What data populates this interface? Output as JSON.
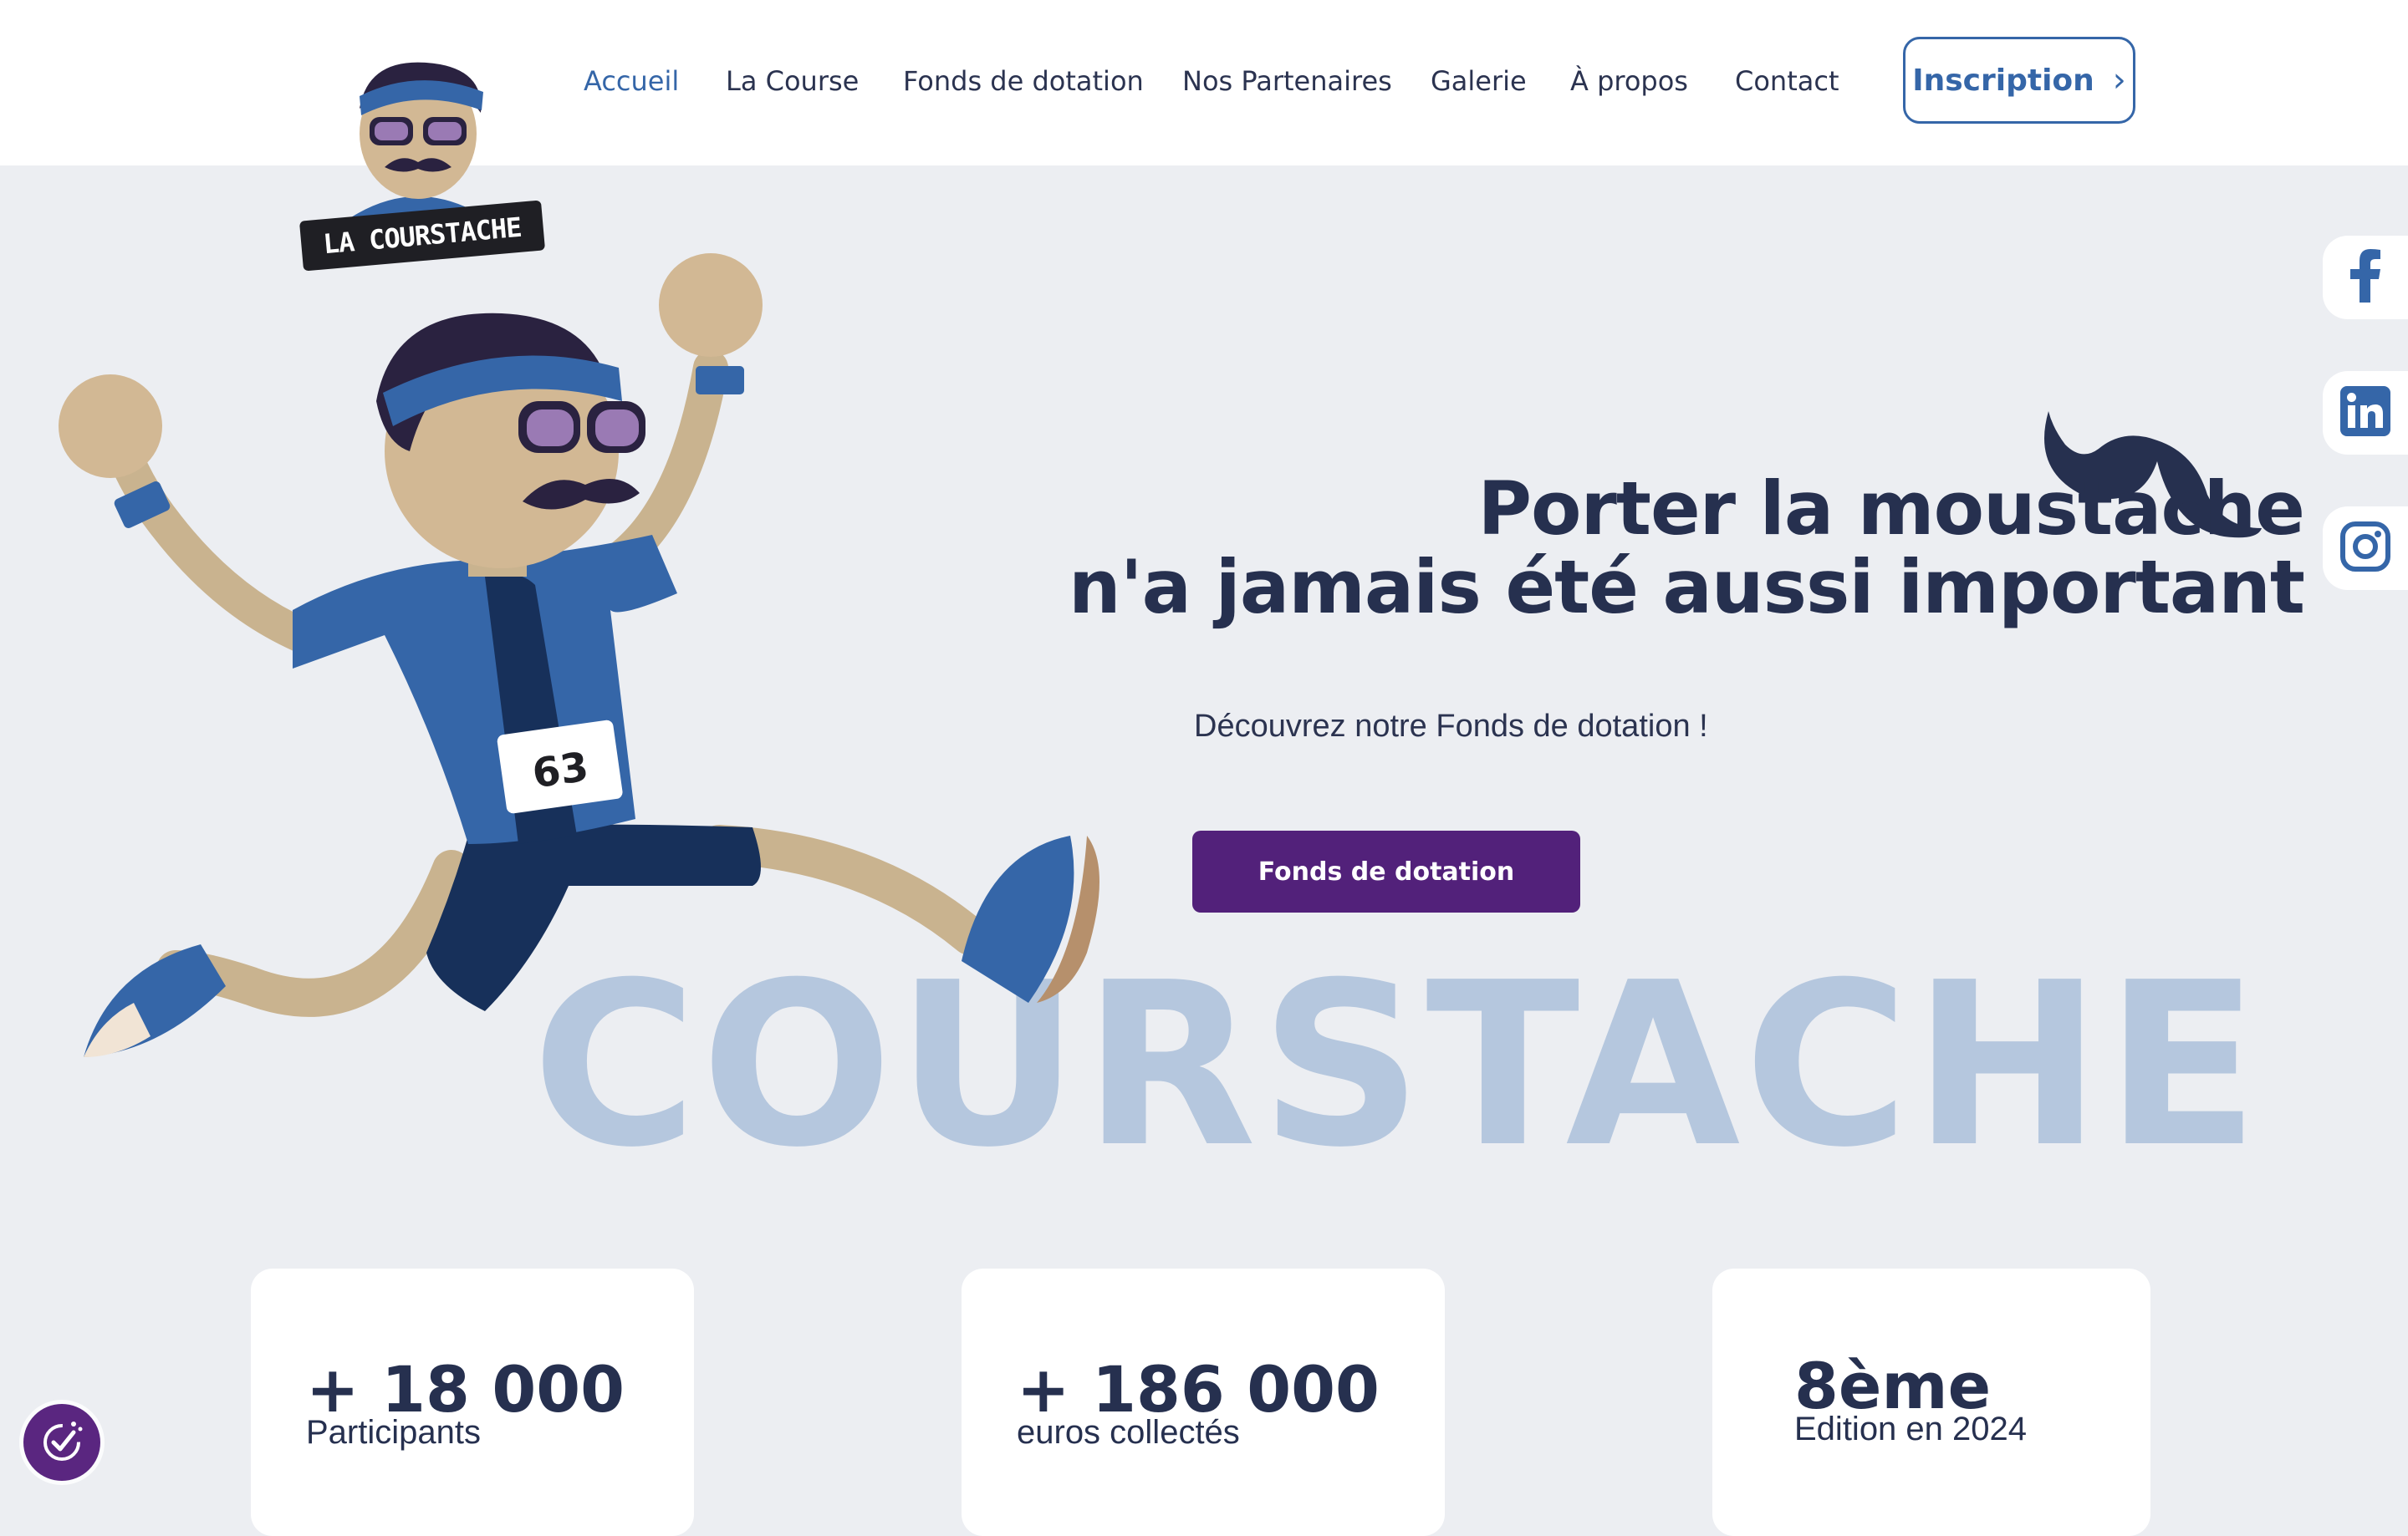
{
  "brand": {
    "logo_text": "LA COURSTACHE"
  },
  "nav": {
    "items": [
      {
        "label": "Accueil",
        "active": true
      },
      {
        "label": "La Course"
      },
      {
        "label": "Fonds de dotation"
      },
      {
        "label": "Nos Partenaires"
      },
      {
        "label": "Galerie"
      },
      {
        "label": "À propos"
      },
      {
        "label": "Contact"
      }
    ],
    "cta_label": "Inscription"
  },
  "social": [
    {
      "icon": "facebook-icon"
    },
    {
      "icon": "linkedin-icon"
    },
    {
      "icon": "instagram-icon"
    }
  ],
  "hero": {
    "title_line1": "Porter la moustache",
    "title_line2": "n'a jamais été aussi important",
    "subtitle": "Découvrez notre Fonds de dotation !",
    "button_label": "Fonds de dotation",
    "background_word": "COURSTACHE",
    "runner_bib": "63"
  },
  "stats": [
    {
      "value": "+ 18 000",
      "label": "Participants"
    },
    {
      "value": "+ 186 000",
      "label": "euros collectés"
    },
    {
      "value": "8ème",
      "label": "Edition en 2024"
    }
  ],
  "colors": {
    "primary": "#3566a8",
    "navy": "#26304f",
    "purple": "#52217a",
    "background": "#eceef2",
    "watermark": "#b5c7de"
  }
}
